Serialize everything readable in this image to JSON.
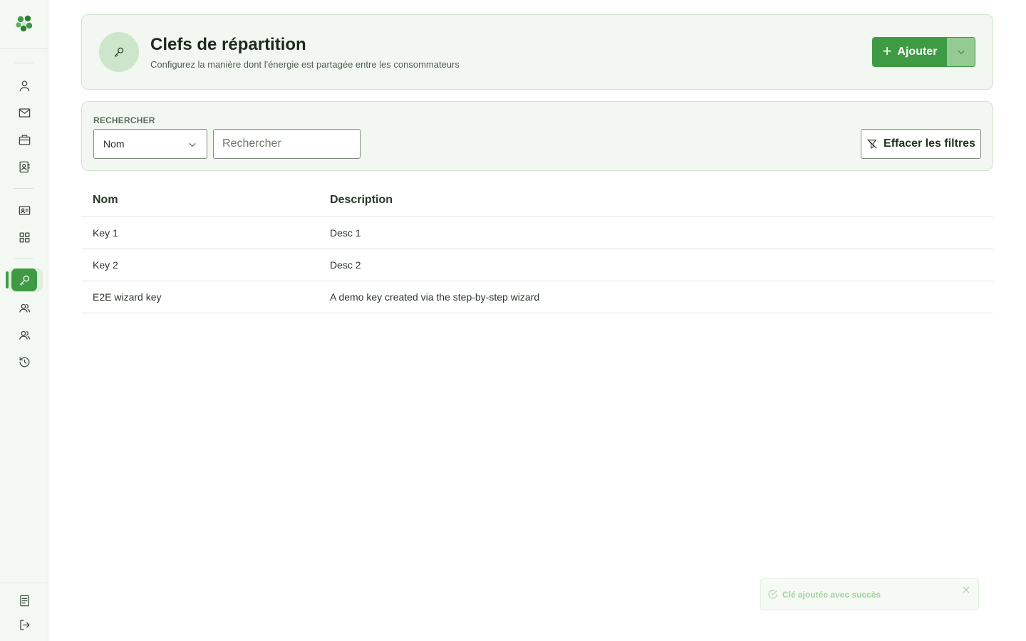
{
  "header": {
    "title": "Clefs de répartition",
    "subtitle": "Configurez la manière dont l'énergie est partagée entre les consommateurs",
    "add_label": "Ajouter",
    "add_plus": "+"
  },
  "filters": {
    "section_label": "RECHERCHER",
    "field_value": "Nom",
    "search_placeholder": "Rechercher",
    "clear_label": "Effacer les filtres"
  },
  "table": {
    "columns": [
      "Nom",
      "Description"
    ],
    "rows": [
      {
        "name": "Key 1",
        "description": "Desc 1"
      },
      {
        "name": "Key 2",
        "description": "Desc 2"
      },
      {
        "name": "E2E wizard key",
        "description": "A demo key created via the step-by-step wizard"
      }
    ]
  },
  "toast": {
    "message": "Clé ajoutée avec succès"
  },
  "sidebar": {
    "icons": [
      "user-icon",
      "mail-icon",
      "briefcase-icon",
      "contact-book-icon",
      "id-card-icon",
      "grid-icon",
      "key-icon",
      "users-icon",
      "group-icon",
      "history-icon",
      "document-icon",
      "logout-icon"
    ],
    "active": "key-icon"
  },
  "colors": {
    "accent": "#3f9a44",
    "card_bg": "#f2f8f1",
    "card_border": "#cfe3cd"
  }
}
